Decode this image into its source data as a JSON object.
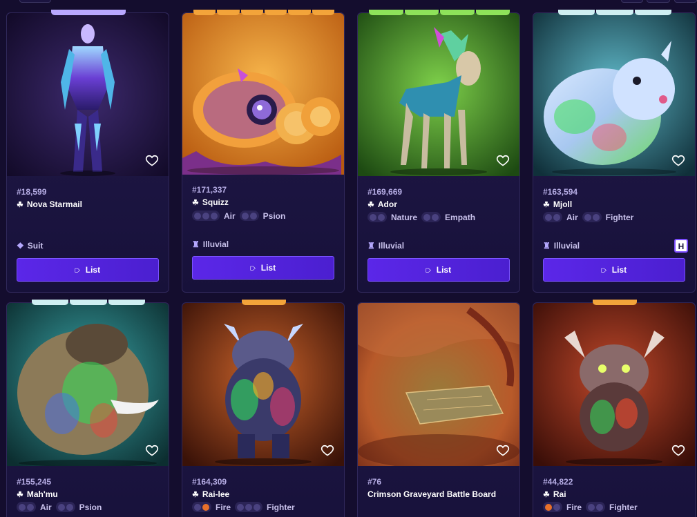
{
  "page": {
    "background": "#140d2e",
    "accent": "#5b27e8"
  },
  "cards": [
    {
      "id": "#18,599",
      "name": "Nova Starmail",
      "name_icon": "cluster-icon",
      "traits": [],
      "category": "Suit",
      "category_icon": "suit-icon",
      "button": "List",
      "rarity_color": "#b9a8ff",
      "image": "nova-starmail-armor-figure",
      "badge": ""
    },
    {
      "id": "#171,337",
      "name": "Squizz",
      "name_icon": "cluster-icon",
      "traits": [
        {
          "label": "Air"
        },
        {
          "label": "Psion"
        }
      ],
      "category": "Illuvial",
      "category_icon": "illuvial-icon",
      "button": "List",
      "rarity_color": "#f3a43a",
      "image": "squizz-orange-octopus",
      "badge": ""
    },
    {
      "id": "#169,669",
      "name": "Ador",
      "name_icon": "cluster-icon",
      "traits": [
        {
          "label": "Nature"
        },
        {
          "label": "Empath"
        }
      ],
      "category": "Illuvial",
      "category_icon": "illuvial-icon",
      "button": "List",
      "rarity_color": "#8ee25a",
      "image": "ador-teal-deer",
      "badge": ""
    },
    {
      "id": "#163,594",
      "name": "Mjoll",
      "name_icon": "cluster-icon",
      "traits": [
        {
          "label": "Air"
        },
        {
          "label": "Fighter"
        }
      ],
      "category": "Illuvial",
      "category_icon": "illuvial-icon",
      "button": "List",
      "rarity_color": "#cfeff2",
      "image": "mjoll-holo-bear",
      "badge": "H"
    },
    {
      "id": "#155,245",
      "name": "Mah'mu",
      "name_icon": "cluster-icon",
      "traits": [
        {
          "label": "Air"
        },
        {
          "label": "Psion"
        }
      ],
      "category": "",
      "category_icon": "",
      "button": "",
      "rarity_color": "#cfeff2",
      "image": "mahmu-holo-mammoth",
      "badge": ""
    },
    {
      "id": "#164,309",
      "name": "Rai-lee",
      "name_icon": "cluster-icon",
      "traits": [
        {
          "label": "Fire"
        },
        {
          "label": "Fighter"
        }
      ],
      "category": "",
      "category_icon": "",
      "button": "",
      "rarity_color": "#f3a43a",
      "image": "rai-lee-holo-creature",
      "badge": ""
    },
    {
      "id": "#76",
      "name": "Crimson Graveyard Battle Board",
      "name_icon": "",
      "traits": [],
      "category": "",
      "category_icon": "",
      "button": "",
      "rarity_color": "",
      "image": "crimson-graveyard-board",
      "badge": ""
    },
    {
      "id": "#44,822",
      "name": "Rai",
      "name_icon": "cluster-icon",
      "traits": [
        {
          "label": "Fire"
        },
        {
          "label": "Fighter"
        }
      ],
      "category": "",
      "category_icon": "",
      "button": "",
      "rarity_color": "#f3a43a",
      "image": "rai-holo-creature",
      "badge": ""
    }
  ]
}
